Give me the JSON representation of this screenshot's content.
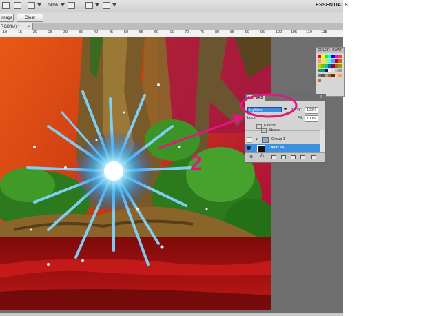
{
  "app": {
    "workspace_label": "ESSENTIALS",
    "zoom_value": "50%"
  },
  "options_bar": {
    "image_button": "Image",
    "clear_button": "Clear"
  },
  "document": {
    "tab_label": "RGB/8#) *",
    "tab_close": "×"
  },
  "ruler": {
    "ticks": [
      "10",
      "15",
      "20",
      "25",
      "30",
      "35",
      "40",
      "45",
      "50",
      "55",
      "60",
      "65",
      "70",
      "75",
      "80",
      "85",
      "90",
      "95",
      "100",
      "105",
      "110",
      "115"
    ]
  },
  "swatches_panel": {
    "tab_color": "COLOR",
    "tab_swatches": "SWAT",
    "colors": [
      "#ff0000",
      "#ffff00",
      "#00ff00",
      "#00ffff",
      "#0000ff",
      "#ff00ff",
      "#ff3c3c",
      "#ff9f4f",
      "#ffe04f",
      "#9fff4f",
      "#4fffe0",
      "#4f9fff",
      "#cc0000",
      "#cc6600",
      "#cccc00",
      "#66cc00",
      "#00cc99",
      "#0066cc",
      "#990033",
      "#996633",
      "#999900",
      "#339933",
      "#009999",
      "#330099",
      "#ffffff",
      "#dddddd",
      "#bbbbbb",
      "#999999",
      "#777777",
      "#555555",
      "#cc9966",
      "#996633",
      "#663300",
      "#ffcc99",
      "#ff9966",
      "#cc6633"
    ]
  },
  "layers_panel": {
    "tab_label": "LAYERS",
    "blend_mode": "Lighten",
    "opacity_label": "pacity:",
    "opacity_value": "100%",
    "lock_label": "Lock:",
    "fill_label": "Fill:",
    "fill_value": "100%",
    "rows": [
      {
        "name": "Effects"
      },
      {
        "name": "Stroke"
      },
      {
        "name": "Group 1"
      },
      {
        "name": "Layer 16"
      }
    ],
    "footer_link": "⊕",
    "footer_fx": "fx"
  },
  "annotation": {
    "step_number": "2",
    "accent_color": "#e3157f"
  }
}
